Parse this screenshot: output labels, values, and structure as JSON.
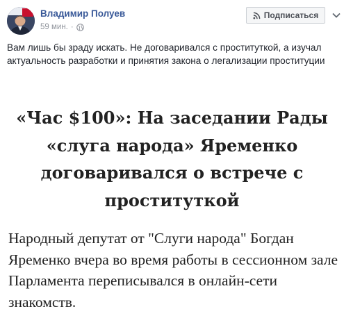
{
  "post": {
    "author": "Владимир Полуев",
    "time": "59 мин.",
    "separator": "·",
    "privacy_icon": "globe-icon",
    "subscribe_icon": "rss-icon",
    "subscribe_label": "Подписаться",
    "more_icon": "chevron-down-icon",
    "text": "Вам лишь бы зраду искать. Не договаривался с проституткой, а изучал актуальность разработки и принятия закона о легализации проституции"
  },
  "article": {
    "headline": "«Час $100»: На заседании Рады «слуга народа» Яременко договаривался о встрече с проституткой",
    "lead": "Народный депутат от \"Слуги народа\" Богдан Яременко вчера во время работы в сессионном зале Парламента переписывался в онлайн-сети знакомств."
  },
  "colors": {
    "author_link": "#385898",
    "meta_gray": "#90949c",
    "body_text": "#1d2129",
    "button_bg": "#f5f6f7",
    "button_border": "#ccd0d5"
  }
}
